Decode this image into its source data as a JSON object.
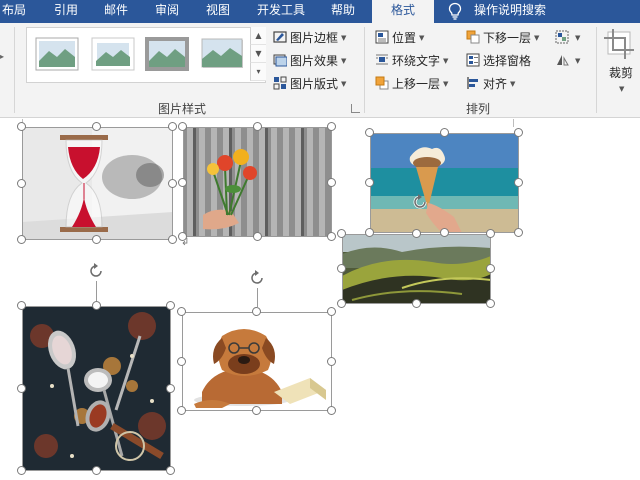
{
  "tabs": {
    "layout": "布局",
    "references": "引用",
    "mailings": "邮件",
    "review": "审阅",
    "view": "视图",
    "developer": "开发工具",
    "help": "帮助",
    "format": "格式",
    "tell_me": "操作说明搜索"
  },
  "picture_styles": {
    "border": "图片边框",
    "effects": "图片效果",
    "layout": "图片版式",
    "group_label": "图片样式"
  },
  "arrange": {
    "position": "位置",
    "wrap_text": "环绕文字",
    "bring_forward": "上移一层",
    "send_backward": "下移一层",
    "selection_pane": "选择窗格",
    "align": "对齐",
    "group_label": "排列"
  },
  "size": {
    "crop": "裁剪"
  },
  "colors": {
    "accent": "#2b579a",
    "ribbon": "#f3f3f3"
  }
}
